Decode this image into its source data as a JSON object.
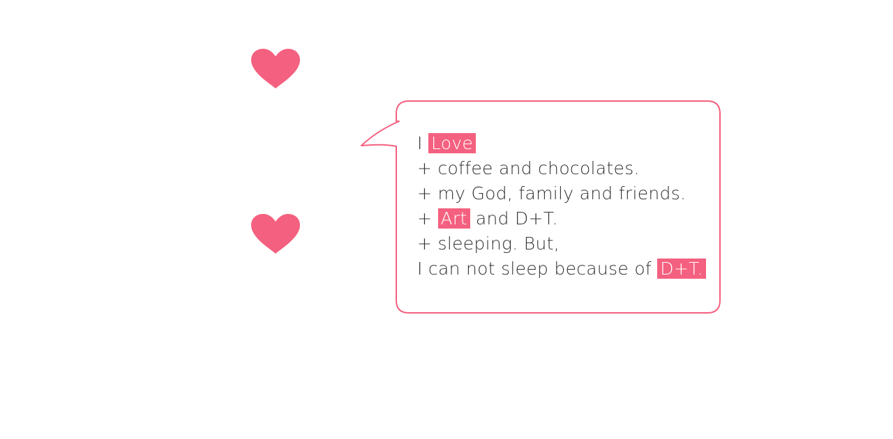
{
  "colors": {
    "accent": "#f4607f",
    "text": "#333333",
    "background": "#ffffff"
  },
  "icons": {
    "top": "heart-icon",
    "bottom": "heart-icon"
  },
  "bubble": {
    "line1": {
      "prefix": "I",
      "highlight": "Love"
    },
    "line2": "+ coffee and chocolates.",
    "line3": "+ my God, family and friends.",
    "line4": {
      "prefix": "+",
      "highlight": "Art",
      "suffix": "and D+T."
    },
    "line5": "+ sleeping. But,",
    "line6": {
      "prefix": "I can not sleep because of",
      "highlight": "D+T."
    }
  }
}
